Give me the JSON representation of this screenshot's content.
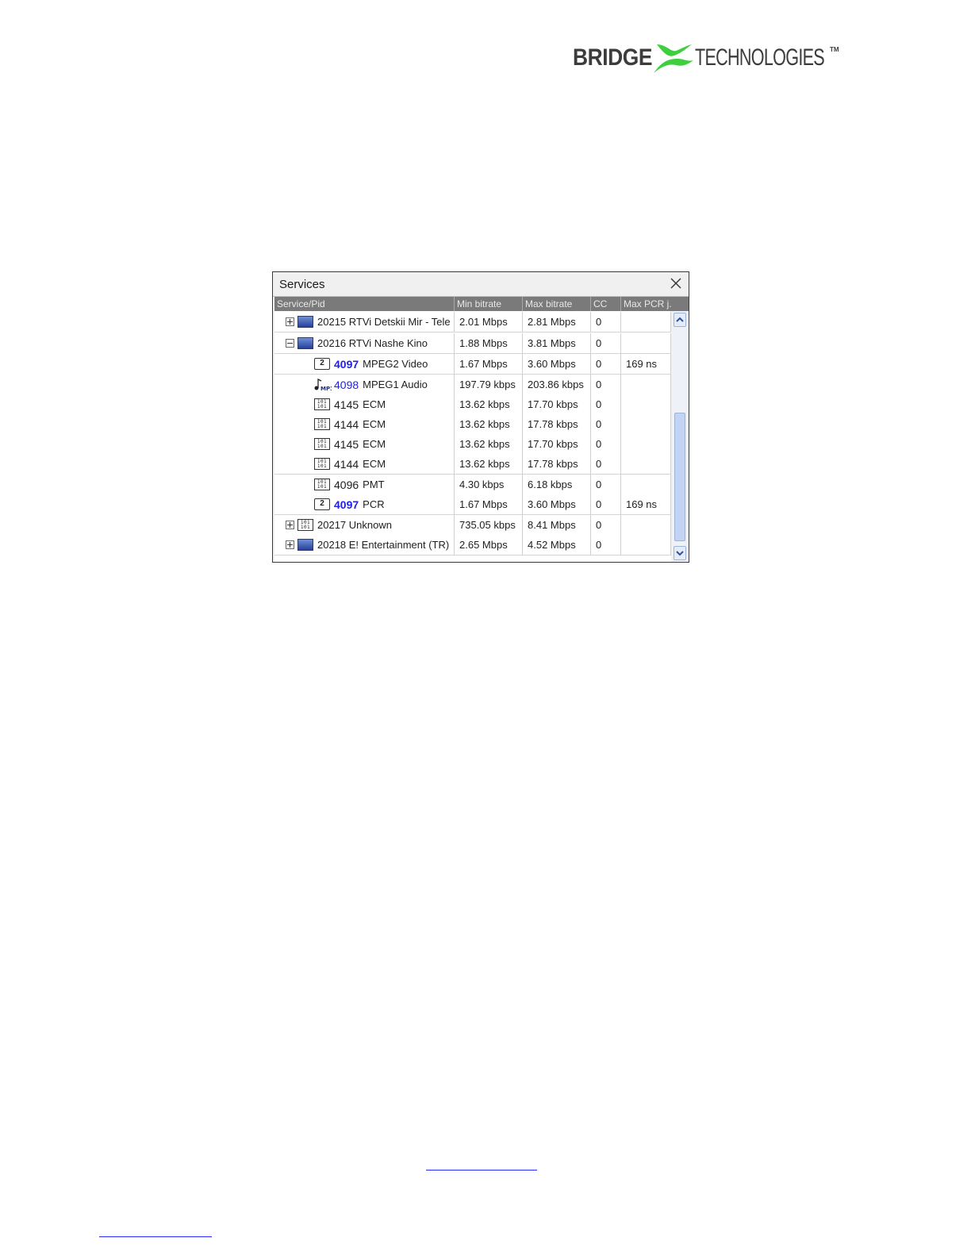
{
  "logo": {
    "left_word": "BRIDGE",
    "right_word": "TECHNOLOGIES",
    "tm": "TM",
    "mark_color": "#3ecf3e"
  },
  "window": {
    "title": "Services",
    "close_icon": "close-icon",
    "columns": [
      "Service/Pid",
      "Min bitrate",
      "Max bitrate",
      "CC",
      "Max PCR j."
    ],
    "rows": [
      {
        "toggle": "plus",
        "icon": "tv-icon",
        "pid": "",
        "label": "20215 RTVi Detskii Mir - Tele",
        "min": "2.01 Mbps",
        "max": "2.81 Mbps",
        "cc": "0",
        "pcr": ""
      },
      {
        "toggle": "minus",
        "icon": "tv-icon",
        "pid": "",
        "label": "20216 RTVi Nashe Kino",
        "min": "1.88 Mbps",
        "max": "3.81 Mbps",
        "cc": "0",
        "pcr": ""
      },
      {
        "toggle": "",
        "icon": "video-icon",
        "pid": "4097",
        "label": "MPEG2 Video",
        "min": "1.67 Mbps",
        "max": "3.60 Mbps",
        "cc": "0",
        "pcr": "169 ns"
      },
      {
        "toggle": "",
        "icon": "mp3-icon",
        "pid": "4098",
        "label": "MPEG1 Audio",
        "min": "197.79 kbps",
        "max": "203.86 kbps",
        "cc": "0",
        "pcr": ""
      },
      {
        "toggle": "",
        "icon": "data-icon",
        "pid": "4145",
        "label": "ECM",
        "min": "13.62 kbps",
        "max": "17.70 kbps",
        "cc": "0",
        "pcr": ""
      },
      {
        "toggle": "",
        "icon": "data-icon",
        "pid": "4144",
        "label": "ECM",
        "min": "13.62 kbps",
        "max": "17.78 kbps",
        "cc": "0",
        "pcr": ""
      },
      {
        "toggle": "",
        "icon": "data-icon",
        "pid": "4145",
        "label": "ECM",
        "min": "13.62 kbps",
        "max": "17.70 kbps",
        "cc": "0",
        "pcr": ""
      },
      {
        "toggle": "",
        "icon": "data-icon",
        "pid": "4144",
        "label": "ECM",
        "min": "13.62 kbps",
        "max": "17.78 kbps",
        "cc": "0",
        "pcr": ""
      },
      {
        "toggle": "",
        "icon": "data-icon",
        "pid": "4096",
        "label": "PMT",
        "min": "4.30 kbps",
        "max": "6.18 kbps",
        "cc": "0",
        "pcr": ""
      },
      {
        "toggle": "",
        "icon": "video-icon",
        "pid": "4097",
        "label": "PCR",
        "min": "1.67 Mbps",
        "max": "3.60 Mbps",
        "cc": "0",
        "pcr": "169 ns"
      },
      {
        "toggle": "plus",
        "icon": "data-icon",
        "pid": "",
        "label": "20217 Unknown",
        "min": "735.05 kbps",
        "max": "8.41 Mbps",
        "cc": "0",
        "pcr": ""
      },
      {
        "toggle": "plus",
        "icon": "tv-icon",
        "pid": "",
        "label": "20218 E! Entertainment (TR)",
        "min": "2.65 Mbps",
        "max": "4.52 Mbps",
        "cc": "0",
        "pcr": ""
      }
    ]
  },
  "colors": {
    "pid_link": "#2222e0",
    "header_bg": "#7a7a7a",
    "scroll_thumb": "#c2d3f4"
  }
}
